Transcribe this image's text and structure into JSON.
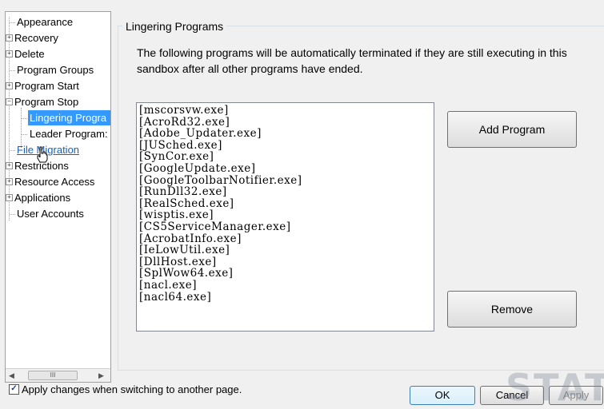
{
  "tree": {
    "items": [
      {
        "label": "Appearance"
      },
      {
        "label": "Recovery"
      },
      {
        "label": "Delete"
      },
      {
        "label": "Program Groups"
      },
      {
        "label": "Program Start"
      },
      {
        "label": "Program Stop"
      },
      {
        "label": "Lingering Progra"
      },
      {
        "label": "Leader Program:"
      },
      {
        "label": "File Migration"
      },
      {
        "label": "Restrictions"
      },
      {
        "label": "Resource Access"
      },
      {
        "label": "Applications"
      },
      {
        "label": "User Accounts"
      }
    ],
    "scroll_thumb": "III"
  },
  "group": {
    "title": "Lingering Programs",
    "description": "The following programs will be automatically terminated if they are still executing in this sandbox after all other programs have ended."
  },
  "programs": [
    "[mscorsvw.exe]",
    "[AcroRd32.exe]",
    "[Adobe_Updater.exe]",
    "[JUSched.exe]",
    "[SynCor.exe]",
    "[GoogleUpdate.exe]",
    "[GoogleToolbarNotifier.exe]",
    "[RunDll32.exe]",
    "[RealSched.exe]",
    "[wisptis.exe]",
    "[CS5ServiceManager.exe]",
    "[AcrobatInfo.exe]",
    "[IeLowUtil.exe]",
    "[DllHost.exe]",
    "[SplWow64.exe]",
    "[nacl.exe]",
    "[nacl64.exe]"
  ],
  "buttons": {
    "add_program": "Add Program",
    "remove": "Remove",
    "ok": "OK",
    "cancel": "Cancel",
    "apply": "Apply"
  },
  "footer": {
    "apply_on_switch_label": "Apply changes when switching to another page.",
    "apply_on_switch_checked": true
  },
  "watermark": "STAT"
}
